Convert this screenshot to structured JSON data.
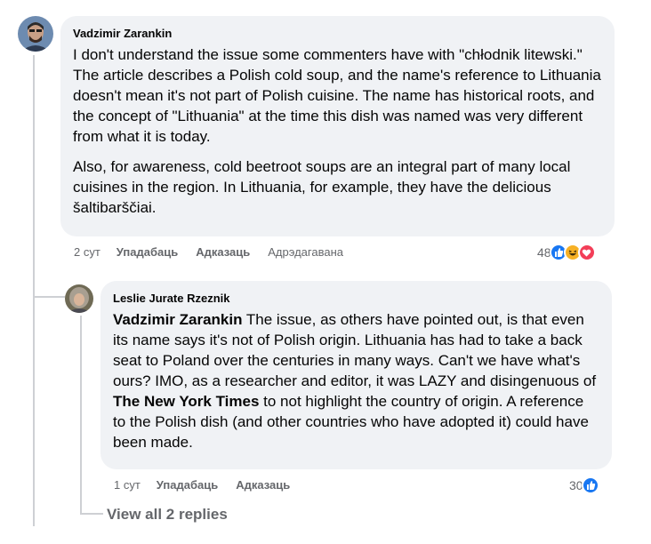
{
  "comment1": {
    "author": "Vadzimir Zarankin",
    "paragraph1": "I don't understand the issue some commenters have with \"chłodnik litewski.\" The article describes a Polish cold soup, and the name's reference to Lithuania doesn't mean it's not part of Polish cuisine. The name has historical roots, and the concept of \"Lithuania\" at the time this dish was named was very different from what it is today.",
    "paragraph2": "Also, for awareness, cold beetroot soups are an integral part of many local cuisines in the region. In Lithuania, for example, they have the delicious šaltibarščiai.",
    "time": "2 сут",
    "like_label": "Упадабаць",
    "reply_label": "Адказаць",
    "edited_label": "Адрэдагавана",
    "reaction_count": "48",
    "reaction_icons": [
      "like-icon",
      "haha-icon",
      "love-icon"
    ]
  },
  "reply1": {
    "author": "Leslie Jurate Rzeznik",
    "mention": "Vadzimir Zarankin",
    "text_part1": " The issue, as others have pointed out, is that even its name says it's not of Polish origin. Lithuania has had to take a back seat to Poland over the centuries in many ways. Can't we have what's ours? IMO, as a researcher and editor, it was LAZY and disingenuous of ",
    "bold_link": "The New York Times",
    "text_part2": " to not highlight the country of origin. A reference to the Polish dish (and other countries who have adopted it) could have been made.",
    "time": "1 сут",
    "like_label": "Упадабаць",
    "reply_label": "Адказаць",
    "reaction_count": "30",
    "reaction_icons": [
      "like-icon"
    ]
  },
  "view_replies": "View all 2 replies",
  "colors": {
    "bubble": "#f0f2f5",
    "secondary_text": "#65676b",
    "like_blue": "#1877f2",
    "thread_line": "#ced0d4"
  }
}
